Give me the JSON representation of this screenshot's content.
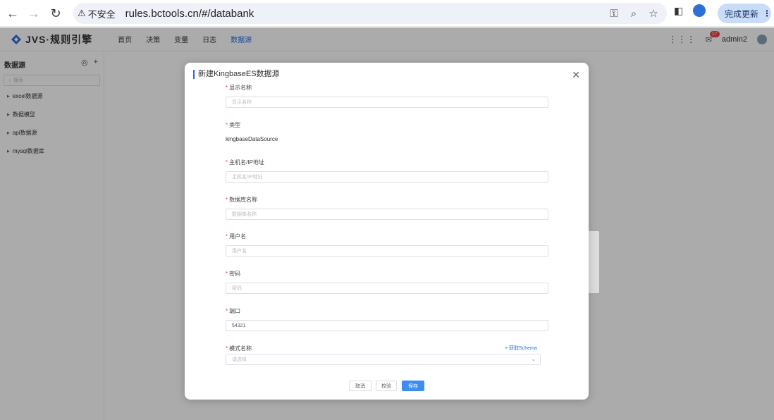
{
  "browser": {
    "insecure_label": "不安全",
    "url": "rules.bctools.cn/#/databank",
    "update_label": "完成更新"
  },
  "app": {
    "logo_text": "JVS·规则引擎",
    "nav": [
      "首页",
      "决策",
      "变量",
      "日志",
      "数据源"
    ],
    "active_nav": "数据源",
    "notification_count": "17",
    "username": "admin2"
  },
  "sidebar": {
    "title": "数据源",
    "search_placeholder": "搜索",
    "items": [
      "excel数据源",
      "数据模型",
      "api数据源",
      "mysql数据库"
    ]
  },
  "modal": {
    "title": "新建KingbaseES数据源",
    "fields": {
      "display_name": {
        "label": "显示名称",
        "placeholder": "显示名称"
      },
      "type": {
        "label": "类型",
        "value": "kingbaseDataSource"
      },
      "host": {
        "label": "主机名/IP地址",
        "placeholder": "主机名/IP地址"
      },
      "database": {
        "label": "数据库名称",
        "placeholder": "数据库名称"
      },
      "username": {
        "label": "用户名",
        "placeholder": "用户名"
      },
      "password": {
        "label": "密码",
        "placeholder": "密码"
      },
      "port": {
        "label": "端口",
        "value": "54321"
      },
      "schema": {
        "label": "模式名称",
        "placeholder": "请选择",
        "action": "获取Schema"
      }
    },
    "buttons": {
      "cancel": "取消",
      "check": "校验",
      "save": "保存"
    }
  },
  "colors": {
    "accent": "#1f6ee8",
    "save_button": "#3d8ef0",
    "required": "#e84545"
  }
}
